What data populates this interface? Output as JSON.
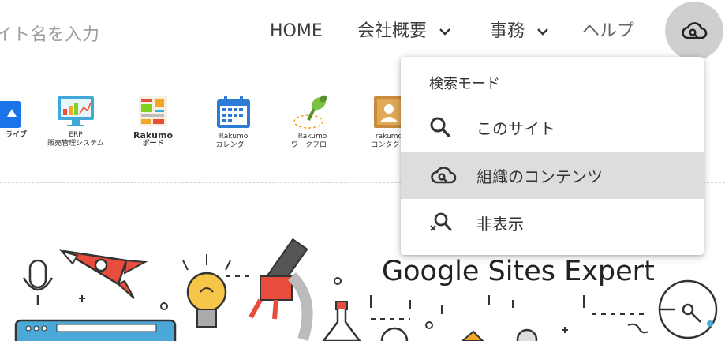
{
  "search": {
    "placeholder_text": "イト名を入力"
  },
  "nav": {
    "items": [
      {
        "label": "HOME",
        "has_dropdown": false
      },
      {
        "label": "会社概要",
        "has_dropdown": true
      },
      {
        "label": "事務",
        "has_dropdown": true
      },
      {
        "label": "ヘルプ",
        "has_dropdown": false
      }
    ],
    "search_mode_icon": "cloud-search-icon"
  },
  "apps": [
    {
      "icon": "drive-icon",
      "label1": "ライブ",
      "label2": ""
    },
    {
      "icon": "erp-icon",
      "label1": "ERP",
      "label2": "販売管理システム"
    },
    {
      "icon": "board-icon",
      "label1": "Rakumo",
      "label2": "ボード"
    },
    {
      "icon": "calendar-icon",
      "label1": "Rakumo",
      "label2": "カレンダー"
    },
    {
      "icon": "workflow-icon",
      "label1": "Rakumo",
      "label2": "ワークフロー"
    },
    {
      "icon": "contacts-icon",
      "label1": "rakumo",
      "label2": "コンタクト"
    }
  ],
  "hero": {
    "title": "Google Sites Expert"
  },
  "search_menu": {
    "header": "検索モード",
    "items": [
      {
        "icon": "search-icon",
        "label": "このサイト",
        "selected": false
      },
      {
        "icon": "cloud-search-icon",
        "label": "組織のコンテンツ",
        "selected": true
      },
      {
        "icon": "search-off-icon",
        "label": "非表示",
        "selected": false
      }
    ]
  },
  "colors": {
    "selected_bg": "#dddddd",
    "menu_bg": "#ffffff",
    "icon_button_bg": "#cfcfcf"
  }
}
